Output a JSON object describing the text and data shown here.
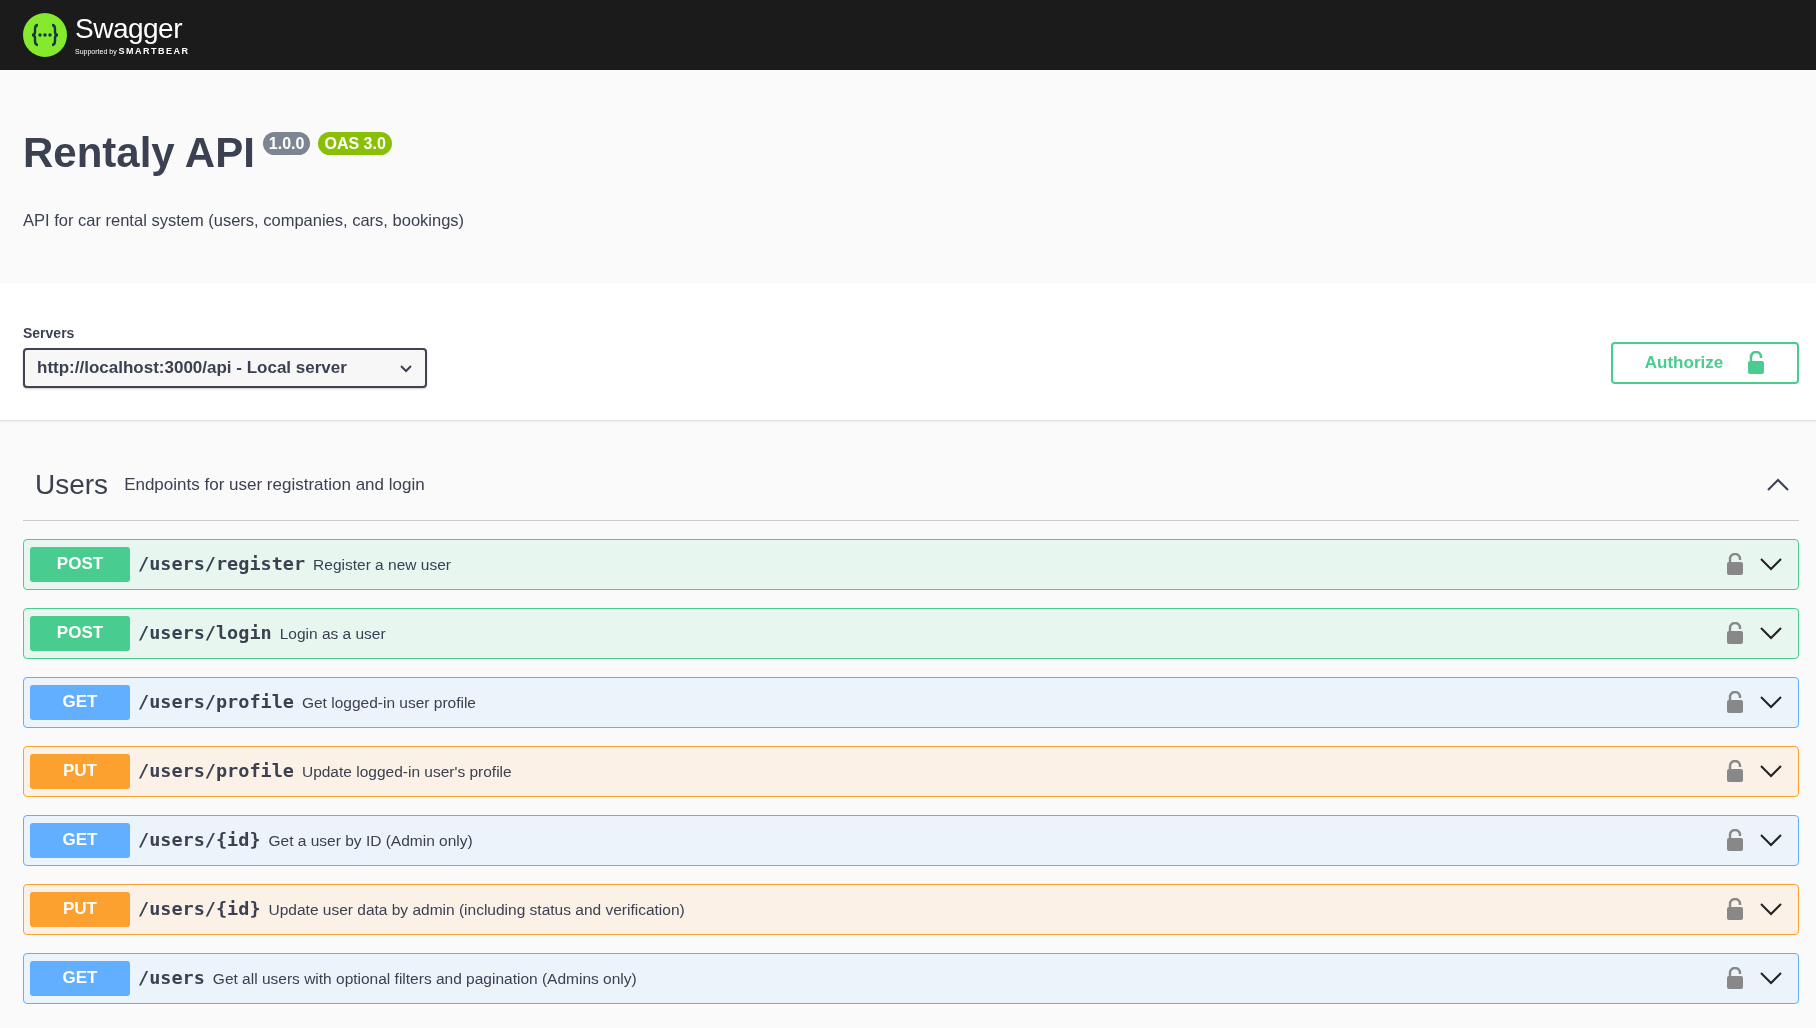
{
  "header": {
    "brand": "Swagger",
    "tagline_prefix": "Supported by",
    "tagline_brand": "SMARTBEAR"
  },
  "info": {
    "title": "Rentaly API",
    "version": "1.0.0",
    "spec": "OAS 3.0",
    "description": "API for car rental system (users, companies, cars, bookings)"
  },
  "servers": {
    "label": "Servers",
    "selected": "http://localhost:3000/api - Local server"
  },
  "authorize": {
    "label": "Authorize"
  },
  "tags": [
    {
      "name": "Users",
      "description": "Endpoints for user registration and login",
      "expanded": true,
      "operations": [
        {
          "method": "POST",
          "path": "/users/register",
          "summary": "Register a new user"
        },
        {
          "method": "POST",
          "path": "/users/login",
          "summary": "Login as a user"
        },
        {
          "method": "GET",
          "path": "/users/profile",
          "summary": "Get logged-in user profile"
        },
        {
          "method": "PUT",
          "path": "/users/profile",
          "summary": "Update logged-in user's profile"
        },
        {
          "method": "GET",
          "path": "/users/{id}",
          "summary": "Get a user by ID (Admin only)"
        },
        {
          "method": "PUT",
          "path": "/users/{id}",
          "summary": "Update user data by admin (including status and verification)"
        },
        {
          "method": "GET",
          "path": "/users",
          "summary": "Get all users with optional filters and pagination (Admins only)"
        }
      ]
    }
  ]
}
